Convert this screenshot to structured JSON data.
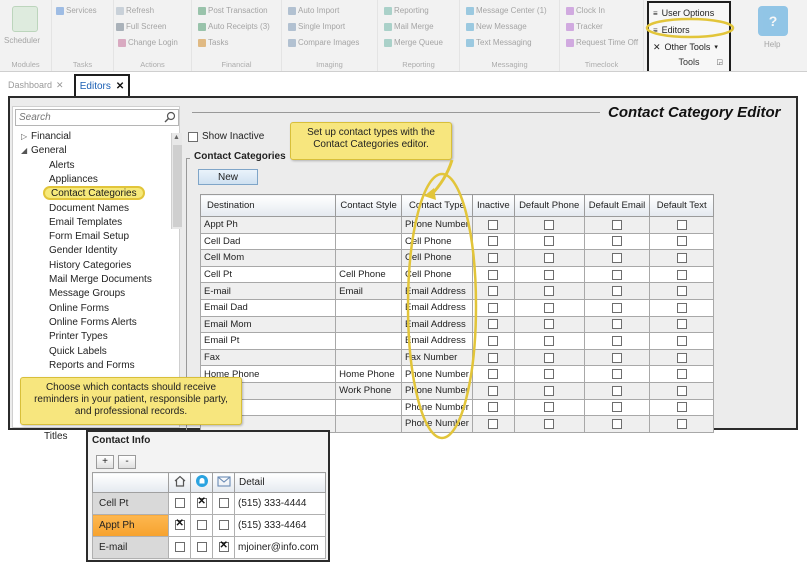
{
  "ribbon": {
    "groups": [
      {
        "caption": "Modules",
        "items": [
          "Scheduler"
        ]
      },
      {
        "caption": "Tasks",
        "items": [
          "Services",
          "Refresh",
          "Full Screen"
        ]
      },
      {
        "caption": "Actions",
        "items": [
          "Change Login",
          "Tasks"
        ]
      },
      {
        "caption": "Financial",
        "items": [
          "Post Transaction",
          "Auto Receipts (3)",
          "Tasks"
        ]
      },
      {
        "caption": "Imaging",
        "items": [
          "Auto Import",
          "Single Import",
          "Compare Images"
        ]
      },
      {
        "caption": "Reporting",
        "items": [
          "Reporting",
          "Mail Merge",
          "Merge Queue"
        ]
      },
      {
        "caption": "Messaging",
        "items": [
          "Message Center (1)",
          "New Message",
          "Text Messaging"
        ]
      },
      {
        "caption": "Timeclock",
        "items": [
          "Clock In",
          "Tracker",
          "Request Time Off"
        ]
      }
    ],
    "tools": {
      "user_options": "User Options",
      "editors": "Editors",
      "other_tools": "Other Tools",
      "caption": "Tools"
    },
    "help": {
      "label": "Help",
      "icon": "help-icon"
    }
  },
  "tabs": {
    "dashboard": "Dashboard",
    "editors": "Editors"
  },
  "sidebar": {
    "search_placeholder": "Search",
    "tree": [
      {
        "label": "Financial",
        "level": 0,
        "arrow": "collapsed"
      },
      {
        "label": "General",
        "level": 0,
        "arrow": "expanded"
      },
      {
        "label": "Alerts",
        "level": 1
      },
      {
        "label": "Appliances",
        "level": 1
      },
      {
        "label": "Contact Categories",
        "level": 1,
        "selected": true
      },
      {
        "label": "Document Names",
        "level": 1
      },
      {
        "label": "Email Templates",
        "level": 1
      },
      {
        "label": "Form Email Setup",
        "level": 1
      },
      {
        "label": "Gender Identity",
        "level": 1
      },
      {
        "label": "History Categories",
        "level": 1
      },
      {
        "label": "Mail Merge Documents",
        "level": 1
      },
      {
        "label": "Message Groups",
        "level": 1
      },
      {
        "label": "Online Forms",
        "level": 1
      },
      {
        "label": "Online Forms Alerts",
        "level": 1
      },
      {
        "label": "Printer Types",
        "level": 1
      },
      {
        "label": "Quick Labels",
        "level": 1
      },
      {
        "label": "Reports and Forms",
        "level": 1
      }
    ],
    "trailing_item": "Titles"
  },
  "editor": {
    "title": "Contact Category Editor",
    "show_inactive_label": "Show Inactive",
    "group_label": "Contact Categories",
    "new_button": "New",
    "columns": [
      "Destination",
      "Contact Style",
      "Contact Type",
      "Inactive",
      "Default Phone",
      "Default Email",
      "Default Text"
    ],
    "rows": [
      {
        "destination": "Appt Ph",
        "style": "",
        "type": "Phone Number"
      },
      {
        "destination": "Cell Dad",
        "style": "",
        "type": "Cell Phone"
      },
      {
        "destination": "Cell Mom",
        "style": "",
        "type": "Cell Phone"
      },
      {
        "destination": "Cell Pt",
        "style": "Cell Phone",
        "type": "Cell Phone"
      },
      {
        "destination": "E-mail",
        "style": "Email",
        "type": "Email Address"
      },
      {
        "destination": "Email Dad",
        "style": "",
        "type": "Email Address"
      },
      {
        "destination": "Email Mom",
        "style": "",
        "type": "Email Address"
      },
      {
        "destination": "Email Pt",
        "style": "",
        "type": "Email Address"
      },
      {
        "destination": "Fax",
        "style": "",
        "type": "Fax Number"
      },
      {
        "destination": "Home Phone",
        "style": "Home Phone",
        "type": "Phone Number"
      },
      {
        "destination": "",
        "style": "Work Phone",
        "type": "Phone Number"
      },
      {
        "destination": "",
        "style": "",
        "type": "Phone Number"
      },
      {
        "destination": "",
        "style": "",
        "type": "Phone Number"
      }
    ]
  },
  "callouts": {
    "top": "Set up contact types with the Contact Categories editor.",
    "bottom": "Choose which contacts should receive reminders in your patient, responsible party, and professional records."
  },
  "contact_info": {
    "title": "Contact Info",
    "add_label": "+",
    "remove_label": "-",
    "detail_header": "Detail",
    "icons": [
      "home-icon",
      "bell-icon",
      "envelope-icon"
    ],
    "rows": [
      {
        "label": "Cell Pt",
        "checks": [
          false,
          true,
          false
        ],
        "detail": "(515) 333-4444"
      },
      {
        "label": "Appt Ph",
        "checks": [
          true,
          false,
          false
        ],
        "detail": "(515) 333-4464",
        "active": true
      },
      {
        "label": "E-mail",
        "checks": [
          false,
          false,
          true
        ],
        "detail": "mjoiner@info.com"
      }
    ]
  },
  "colors": {
    "accent": "#1a5fb4",
    "callout": "#f7e67e",
    "highlight_ring": "#e2c53a",
    "active_row": "#f6a22e"
  }
}
